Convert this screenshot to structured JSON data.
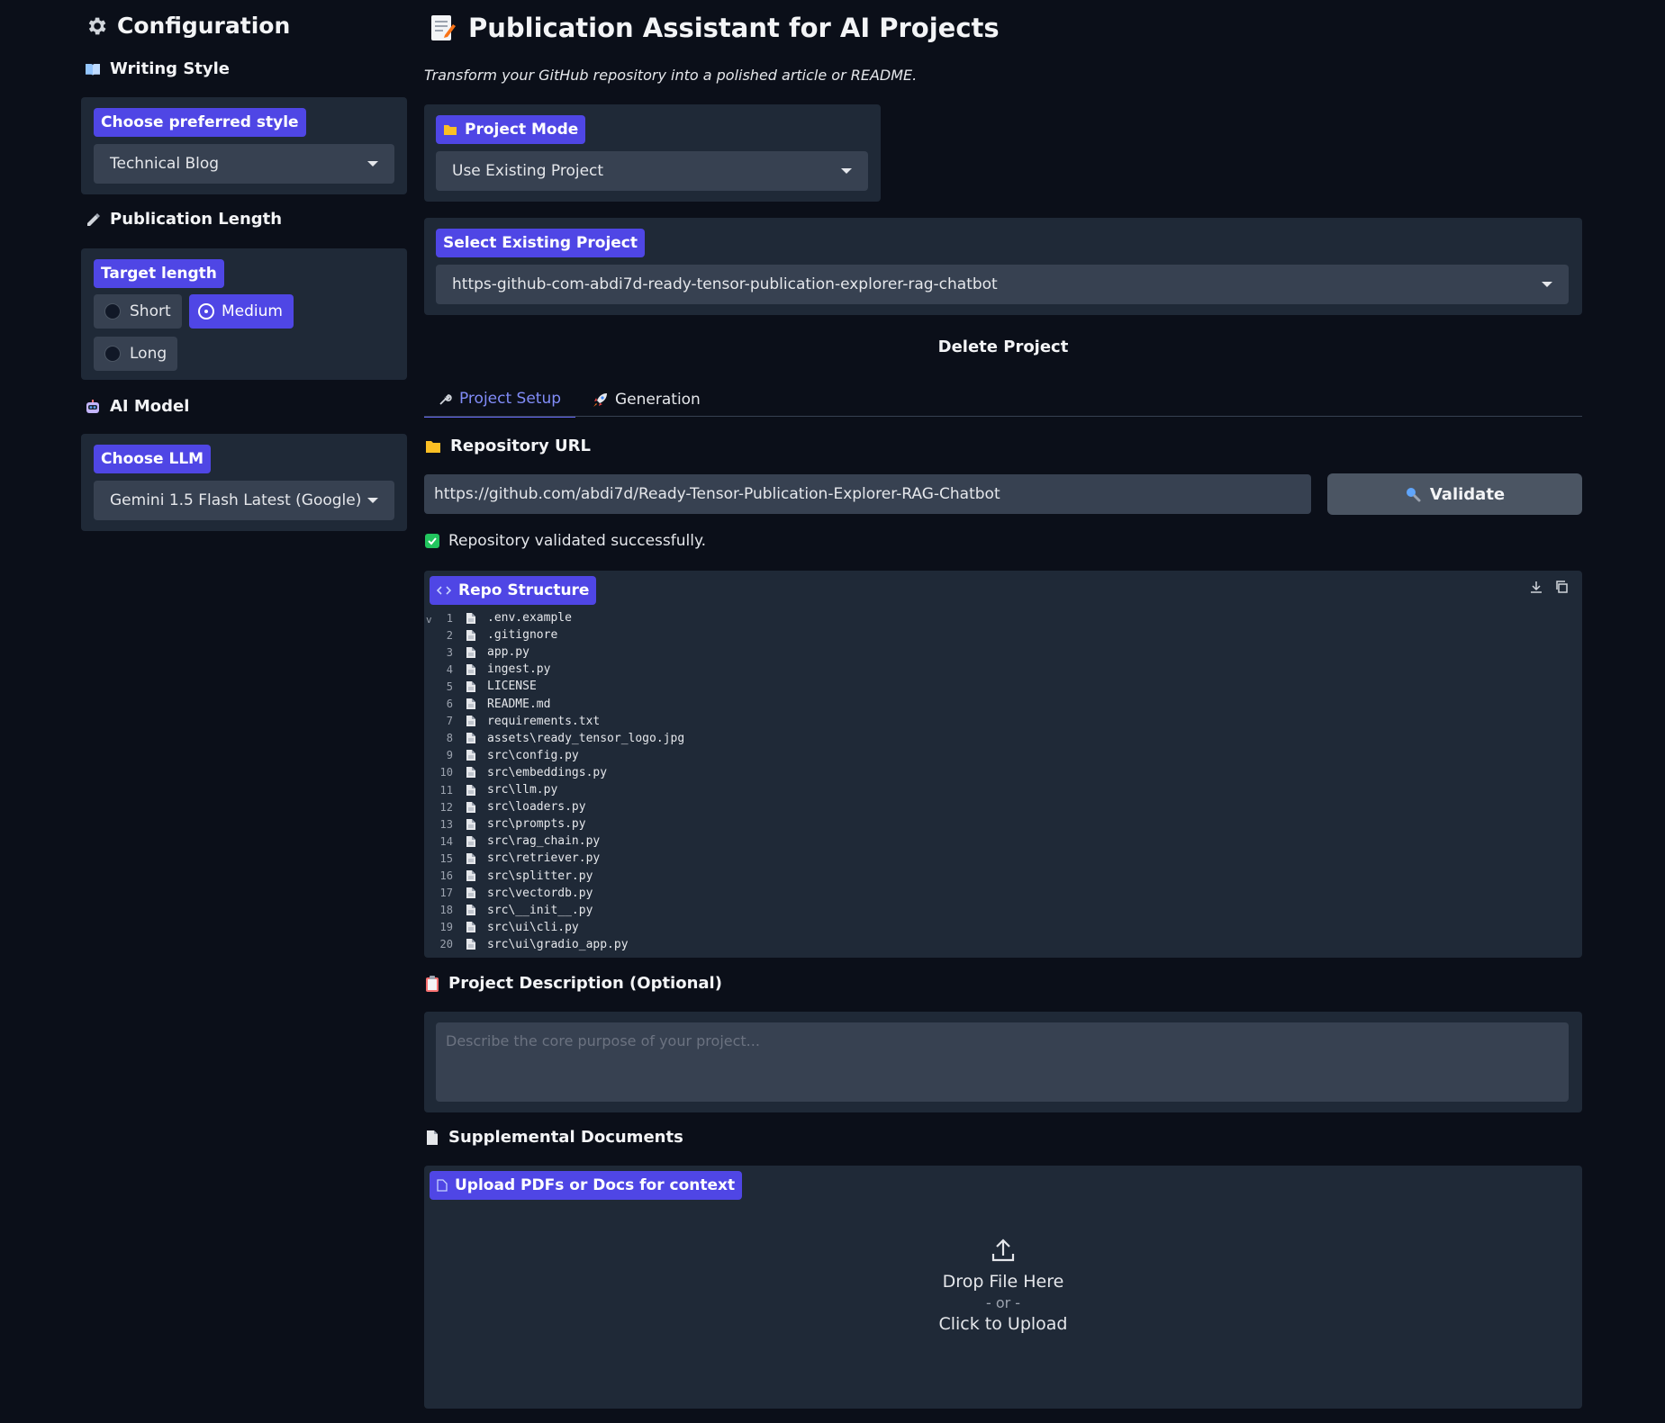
{
  "sidebar": {
    "title": "Configuration",
    "writing_style": {
      "heading": "Writing Style",
      "label": "Choose preferred style",
      "value": "Technical Blog"
    },
    "publication_length": {
      "heading": "Publication Length",
      "label": "Target length",
      "options": [
        "Short",
        "Medium",
        "Long"
      ],
      "selected": "Medium"
    },
    "ai_model": {
      "heading": "AI Model",
      "label": "Choose LLM",
      "value": "Gemini 1.5 Flash Latest (Google)"
    }
  },
  "main": {
    "title": "Publication Assistant for AI Projects",
    "subtitle": "Transform your GitHub repository into a polished article or README.",
    "project_mode": {
      "label": "Project Mode",
      "value": "Use Existing Project"
    },
    "existing_project": {
      "label": "Select Existing Project",
      "value": "https-github-com-abdi7d-ready-tensor-publication-explorer-rag-chatbot"
    },
    "delete_label": "Delete Project",
    "tabs": [
      {
        "label": "Project Setup",
        "active": true
      },
      {
        "label": "Generation",
        "active": false
      }
    ],
    "repo": {
      "heading": "Repository URL",
      "url": "https://github.com/abdi7d/Ready-Tensor-Publication-Explorer-RAG-Chatbot",
      "validate_label": "Validate",
      "status": "Repository validated successfully."
    },
    "repo_structure": {
      "label": "Repo Structure",
      "fold_marker": "v",
      "lines": [
        ".env.example",
        ".gitignore",
        "app.py",
        "ingest.py",
        "LICENSE",
        "README.md",
        "requirements.txt",
        "assets\\ready_tensor_logo.jpg",
        "src\\config.py",
        "src\\embeddings.py",
        "src\\llm.py",
        "src\\loaders.py",
        "src\\prompts.py",
        "src\\rag_chain.py",
        "src\\retriever.py",
        "src\\splitter.py",
        "src\\vectordb.py",
        "src\\__init__.py",
        "src\\ui\\cli.py",
        "src\\ui\\gradio_app.py"
      ]
    },
    "description": {
      "heading": "Project Description (Optional)",
      "placeholder": "Describe the core purpose of your project..."
    },
    "supplemental": {
      "heading": "Supplemental Documents",
      "label": "Upload PDFs or Docs for context",
      "drop": "Drop File Here",
      "or": "- or -",
      "click": "Click to Upload"
    }
  },
  "colors": {
    "background": "#0b0f19",
    "panel": "#1f2937",
    "input": "#374151",
    "accent": "#4f46e5",
    "tab_active": "#818cf8"
  }
}
